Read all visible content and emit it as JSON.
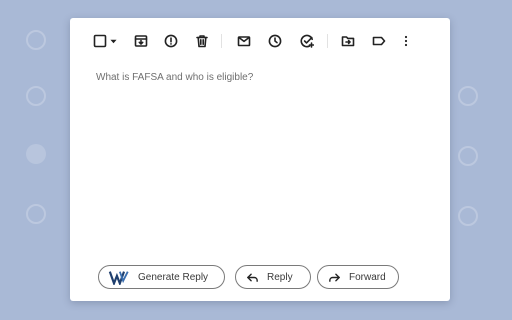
{
  "email": {
    "subject": "What is FAFSA and who is eligible?"
  },
  "toolbar": {
    "icons": [
      "checkbox-icon",
      "dropdown-caret-icon",
      "archive-icon",
      "report-spam-icon",
      "delete-icon",
      "mark-unread-icon",
      "snooze-icon",
      "add-to-tasks-icon",
      "move-to-icon",
      "label-icon",
      "more-options-icon"
    ]
  },
  "actions": {
    "generate_reply_label": "Generate Reply",
    "reply_label": "Reply",
    "forward_label": "Forward"
  },
  "colors": {
    "background": "#a9b9d6",
    "card": "#ffffff",
    "logo": "#1f3f6e"
  }
}
